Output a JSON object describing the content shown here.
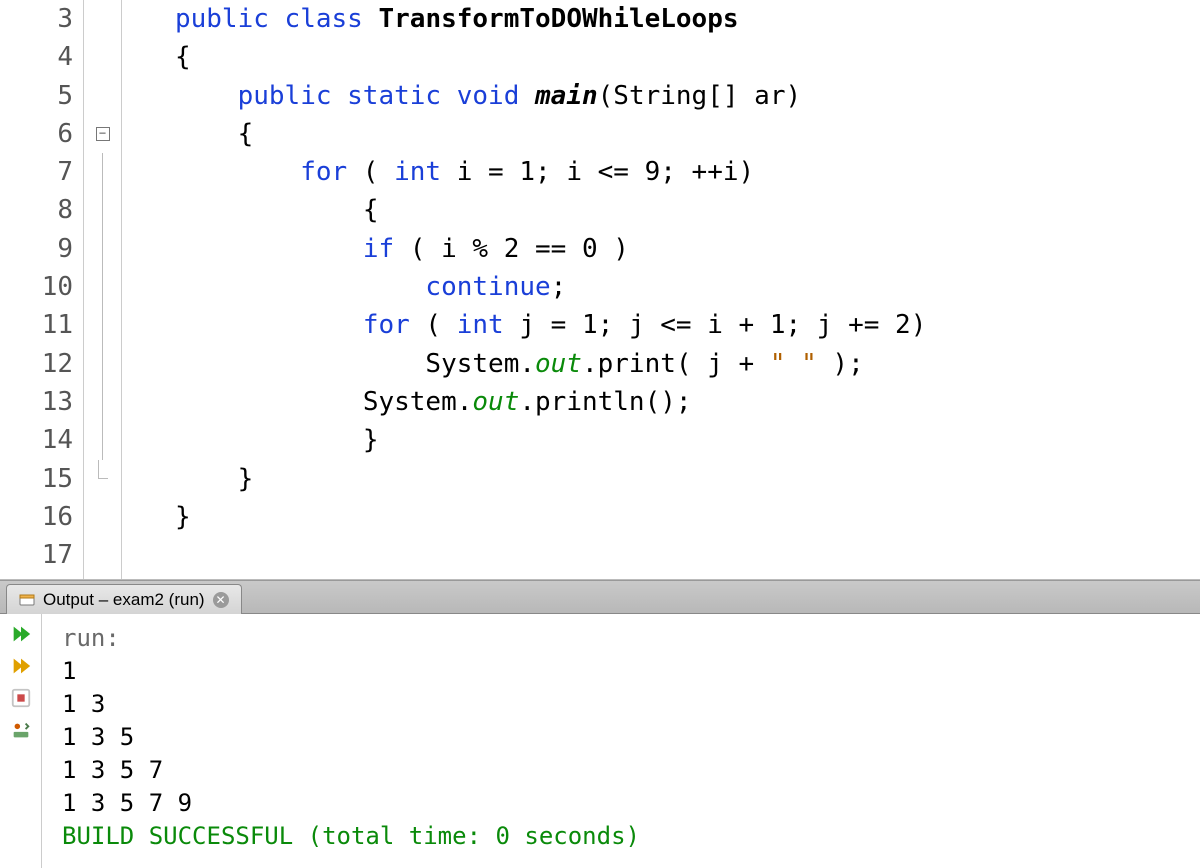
{
  "editor": {
    "line_numbers": [
      "3",
      "4",
      "5",
      "6",
      "7",
      "8",
      "9",
      "10",
      "11",
      "12",
      "13",
      "14",
      "15",
      "16",
      "17"
    ],
    "fold_collapse_row": "6",
    "fold_end_row": "15",
    "code_lines": {
      "3": {
        "indent": "   ",
        "tokens": [
          {
            "t": "public",
            "c": "kw"
          },
          {
            "t": " "
          },
          {
            "t": "class",
            "c": "kw"
          },
          {
            "t": " "
          },
          {
            "t": "TransformToDOWhileLoops",
            "c": "ident-bold"
          }
        ]
      },
      "4": {
        "indent": "   ",
        "tokens": [
          {
            "t": "{"
          }
        ]
      },
      "5": {
        "indent": "       ",
        "tokens": [
          {
            "t": "public",
            "c": "kw"
          },
          {
            "t": " "
          },
          {
            "t": "static",
            "c": "kw"
          },
          {
            "t": " "
          },
          {
            "t": "void",
            "c": "kw"
          },
          {
            "t": " "
          },
          {
            "t": "main",
            "c": "mname"
          },
          {
            "t": "(String[] ar)"
          }
        ]
      },
      "6": {
        "indent": "       ",
        "tokens": [
          {
            "t": "{"
          }
        ]
      },
      "7": {
        "indent": "           ",
        "tokens": [
          {
            "t": "for",
            "c": "kw"
          },
          {
            "t": " ( "
          },
          {
            "t": "int",
            "c": "kw"
          },
          {
            "t": " i = 1; i <= 9; ++i)"
          }
        ]
      },
      "8": {
        "indent": "               ",
        "tokens": [
          {
            "t": "{"
          }
        ]
      },
      "9": {
        "indent": "               ",
        "tokens": [
          {
            "t": "if",
            "c": "kw"
          },
          {
            "t": " ( i % 2 == 0 )"
          }
        ]
      },
      "10": {
        "indent": "                   ",
        "tokens": [
          {
            "t": "continue",
            "c": "kw"
          },
          {
            "t": ";"
          }
        ]
      },
      "11": {
        "indent": "               ",
        "tokens": [
          {
            "t": "for",
            "c": "kw"
          },
          {
            "t": " ( "
          },
          {
            "t": "int",
            "c": "kw"
          },
          {
            "t": " j = 1; j <= i + 1; j += 2)"
          }
        ]
      },
      "12": {
        "indent": "                   ",
        "tokens": [
          {
            "t": "System."
          },
          {
            "t": "out",
            "c": "out"
          },
          {
            "t": ".print( j + "
          },
          {
            "t": "\" \"",
            "c": "str"
          },
          {
            "t": " );"
          }
        ]
      },
      "13": {
        "indent": "               ",
        "tokens": [
          {
            "t": "System."
          },
          {
            "t": "out",
            "c": "out"
          },
          {
            "t": ".println();"
          }
        ]
      },
      "14": {
        "indent": "               ",
        "tokens": [
          {
            "t": "}"
          }
        ]
      },
      "15": {
        "indent": "       ",
        "tokens": [
          {
            "t": "}"
          }
        ]
      },
      "16": {
        "indent": "   ",
        "tokens": [
          {
            "t": "}"
          }
        ]
      },
      "17": {
        "indent": "",
        "tokens": []
      }
    }
  },
  "output_tab": {
    "label": "Output – exam2 (run)"
  },
  "output": {
    "run_label": "run:",
    "lines": [
      "1 ",
      "1 3 ",
      "1 3 5 ",
      "1 3 5 7 ",
      "1 3 5 7 9 "
    ],
    "build_msg": "BUILD SUCCESSFUL (total time: 0 seconds)"
  }
}
